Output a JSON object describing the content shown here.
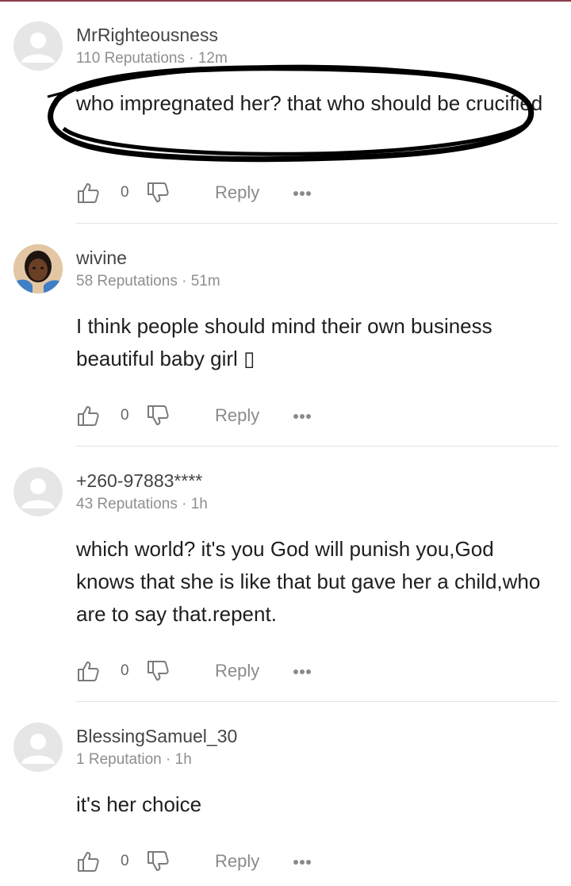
{
  "comments": [
    {
      "username": "MrRighteousness",
      "meta": "110 Reputations · 12m",
      "text": "who impregnated her? that who should be crucified",
      "likes": "0",
      "reply_label": "Reply",
      "avatar": "default-avatar-icon"
    },
    {
      "username": "wivine",
      "meta": "58 Reputations · 51m",
      "text": "I think people should mind their own business beautiful baby girl ▯",
      "likes": "0",
      "reply_label": "Reply",
      "avatar": "user-photo"
    },
    {
      "username": "+260-97883****",
      "meta": "43 Reputations · 1h",
      "text": "which world? it's you God will punish you,God knows that she is like that but gave her a child,who are to say that.repent.",
      "likes": "0",
      "reply_label": "Reply",
      "avatar": "default-avatar-icon"
    },
    {
      "username": "BlessingSamuel_30",
      "meta": "1 Reputation · 1h",
      "text": "it's her choice",
      "likes": "0",
      "reply_label": "Reply",
      "avatar": "default-avatar-icon"
    }
  ],
  "icons": {
    "like": "thumbs-up-icon",
    "dislike": "thumbs-down-icon",
    "more": "more-dots-icon"
  },
  "colors": {
    "accent_line": "#8a3a4a",
    "scribble": "#000000"
  }
}
